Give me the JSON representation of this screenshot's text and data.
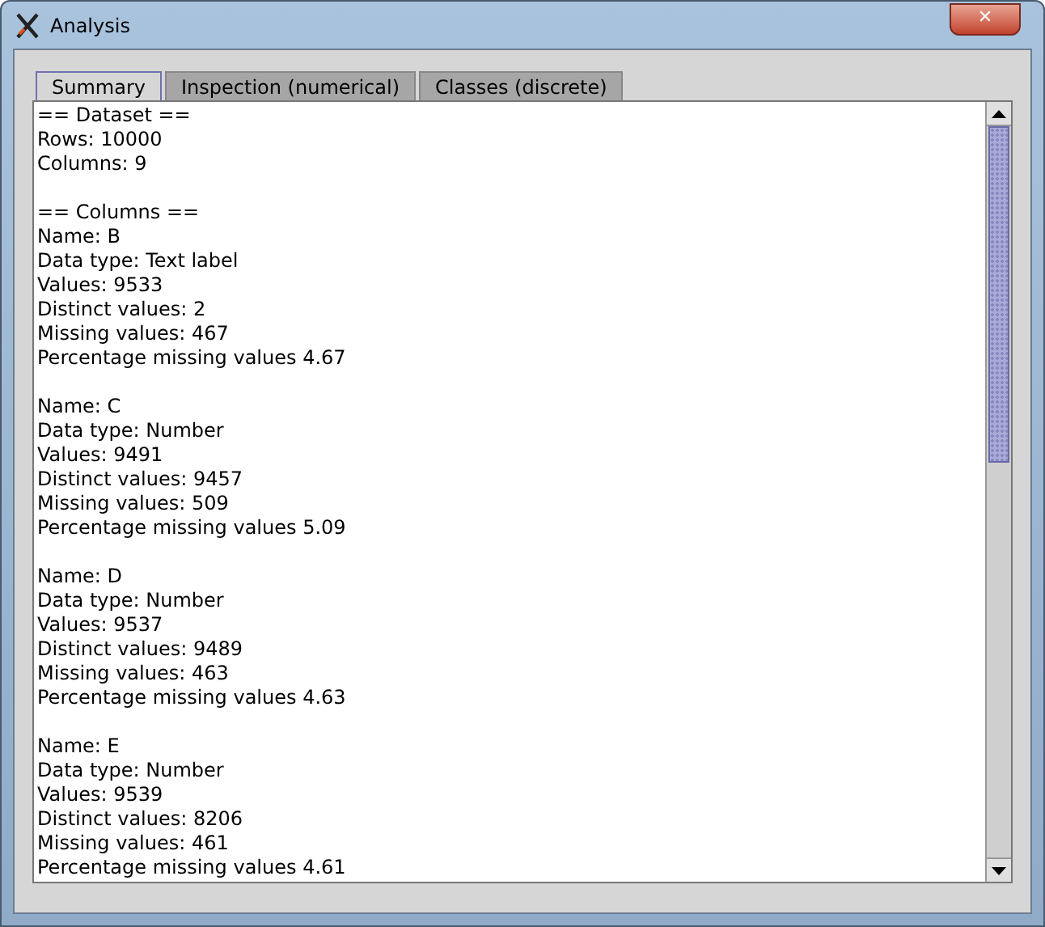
{
  "window": {
    "title": "Analysis",
    "close": "✕"
  },
  "tabs": [
    {
      "label": "Summary",
      "selected": true
    },
    {
      "label": "Inspection (numerical)",
      "selected": false
    },
    {
      "label": "Classes (discrete)",
      "selected": false
    }
  ],
  "report": [
    [
      "== Dataset ==",
      "Rows: 10000",
      "Columns: 9"
    ],
    [
      "== Columns ==",
      "Name: B",
      "Data type: Text label",
      "Values: 9533",
      "Distinct values: 2",
      "Missing values: 467",
      "Percentage missing values 4.67"
    ],
    [
      "Name: C",
      "Data type: Number",
      "Values: 9491",
      "Distinct values: 9457",
      "Missing values: 509",
      "Percentage missing values 5.09"
    ],
    [
      "Name: D",
      "Data type: Number",
      "Values: 9537",
      "Distinct values: 9489",
      "Missing values: 463",
      "Percentage missing values 4.63"
    ],
    [
      "Name: E",
      "Data type: Number",
      "Values: 9539",
      "Distinct values: 8206",
      "Missing values: 461",
      "Percentage missing values 4.61"
    ]
  ]
}
